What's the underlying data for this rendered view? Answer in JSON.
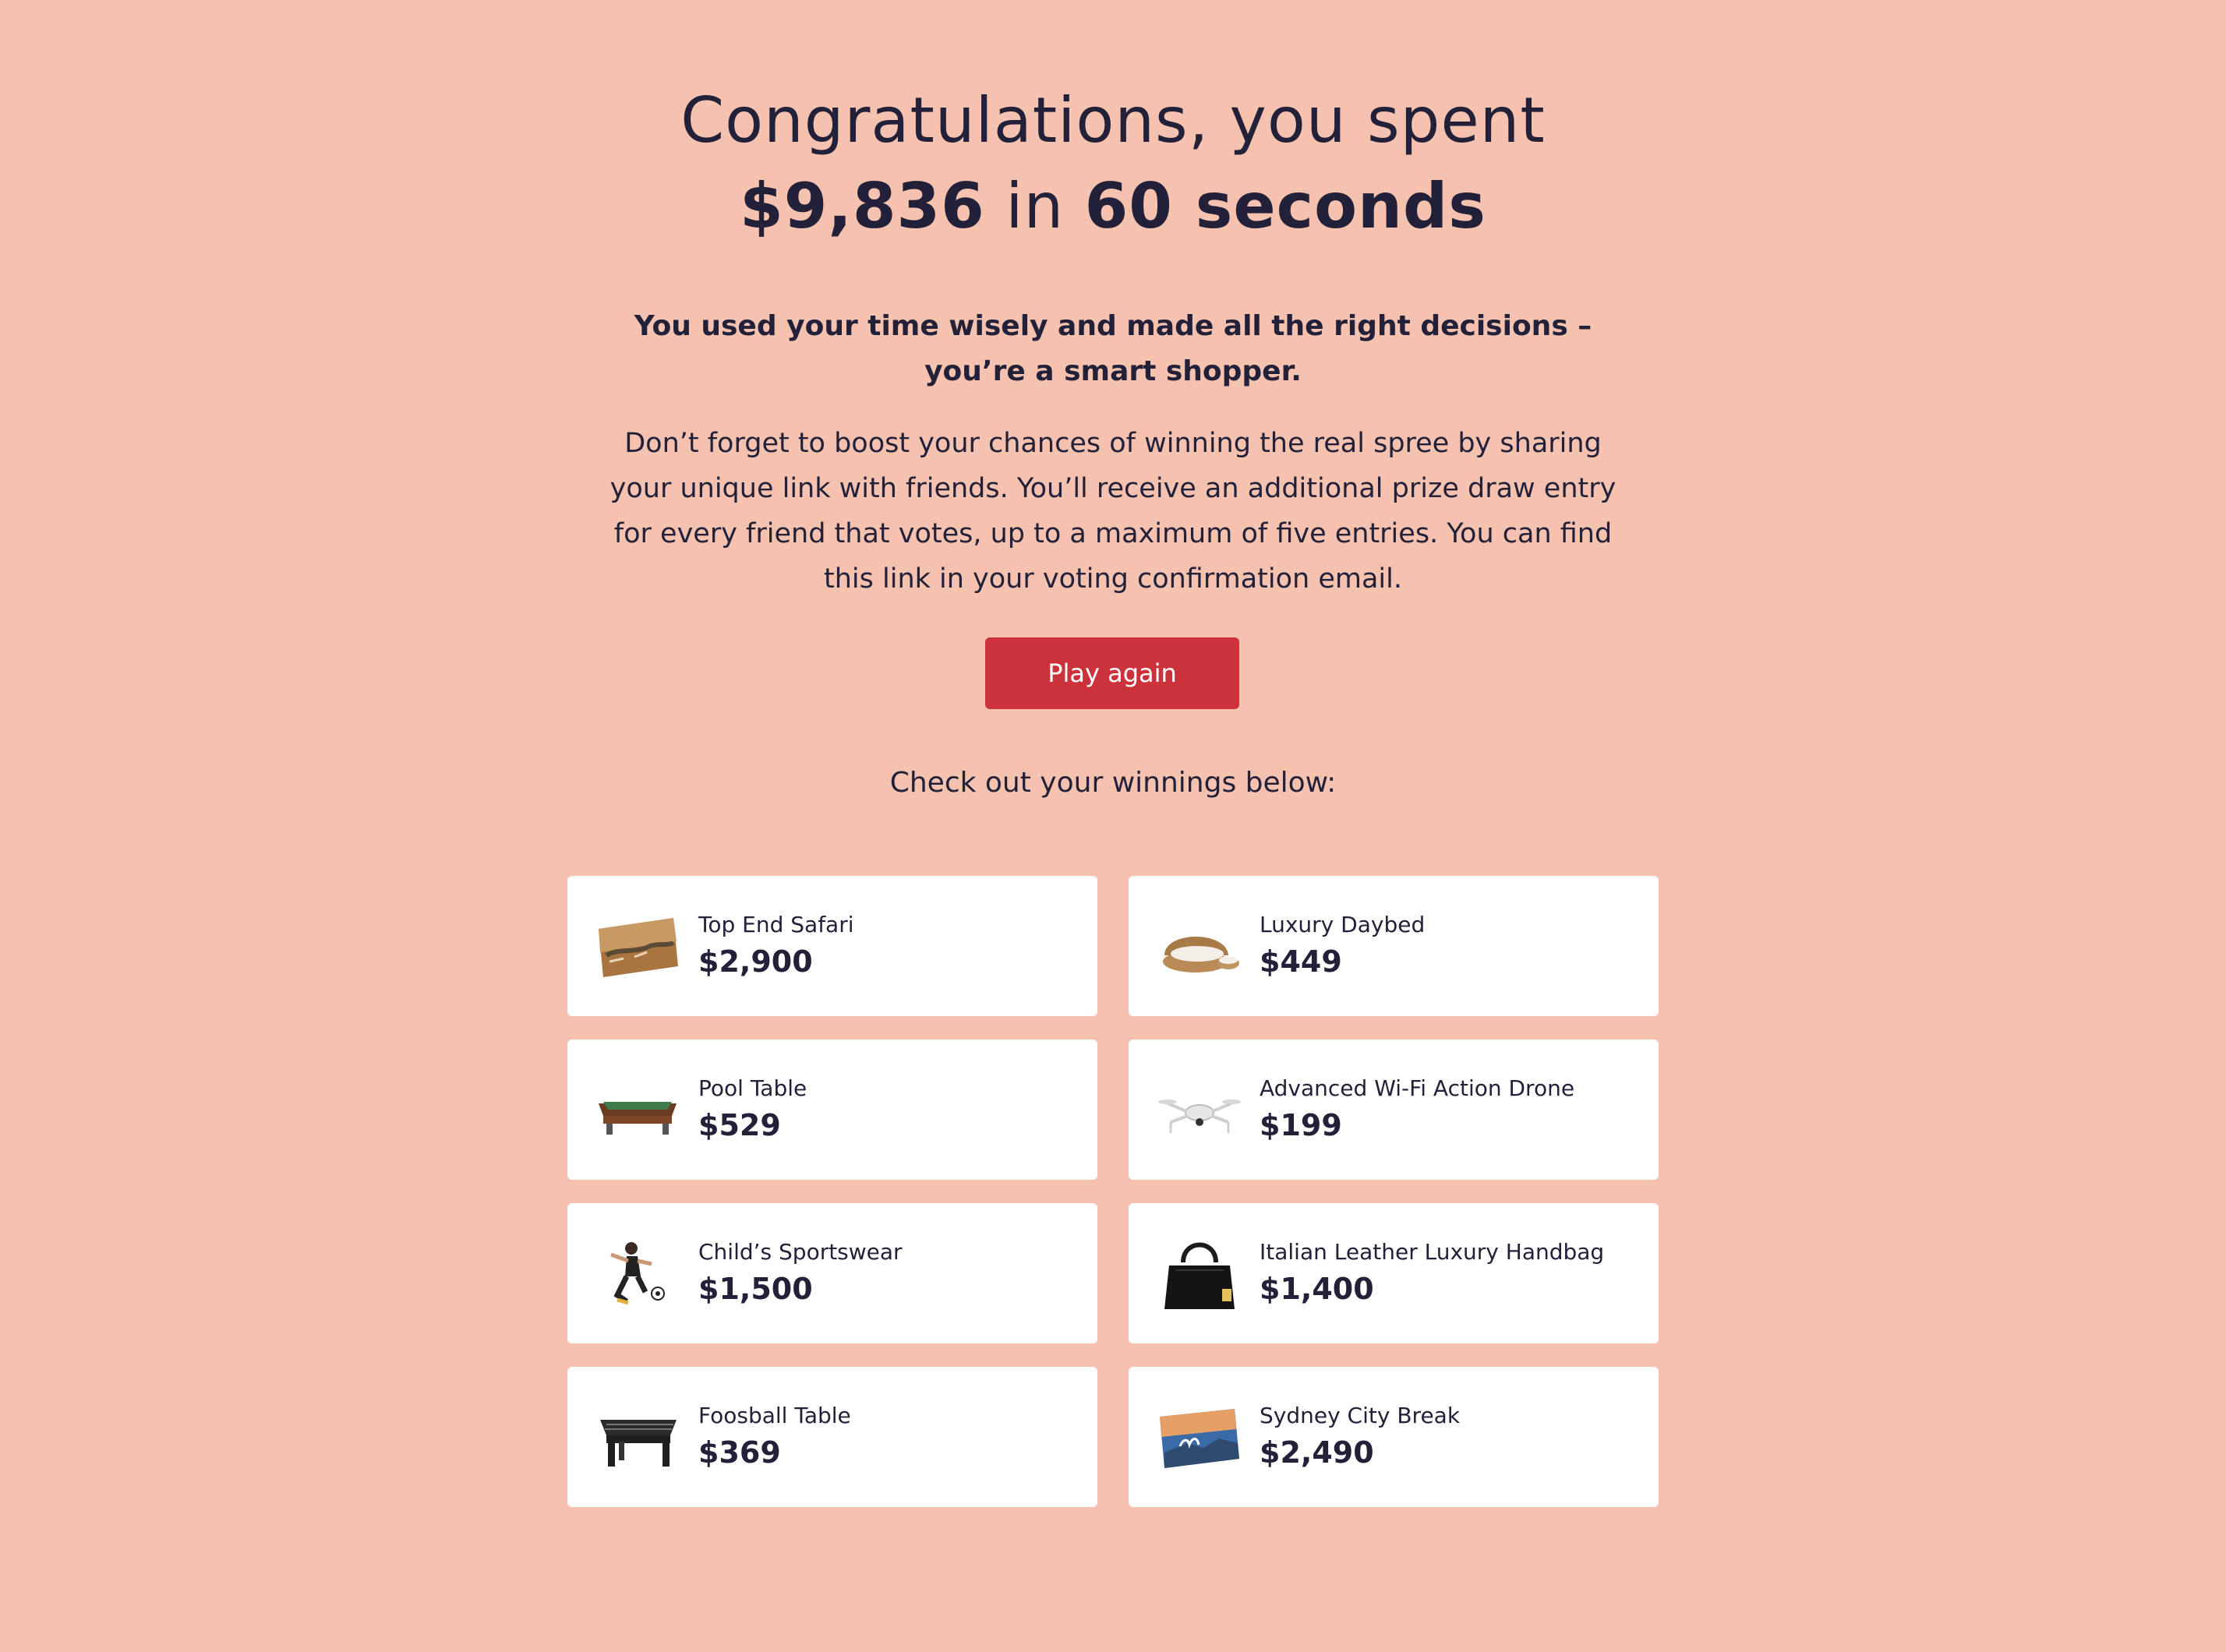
{
  "headline": {
    "line1": "Congratulations, you spent",
    "amount": "$9,836",
    "connector": " in ",
    "duration": "60 seconds"
  },
  "lead": "You used your time wisely and made all the right decisions – you’re a smart shopper.",
  "body": "Don’t forget to boost your chances of winning the real spree by sharing your unique link with friends. You’ll receive an additional prize draw entry for every friend that votes, up to a maximum of five entries. You can find this link in your voting confirmation email.",
  "play_again_label": "Play again",
  "winnings_label": "Check out your winnings below:",
  "prizes": [
    {
      "name": "Top End Safari",
      "price": "$2,900",
      "icon": "safari-icon"
    },
    {
      "name": "Luxury Daybed",
      "price": "$449",
      "icon": "daybed-icon"
    },
    {
      "name": "Pool Table",
      "price": "$529",
      "icon": "pool-table-icon"
    },
    {
      "name": "Advanced Wi-Fi Action Drone",
      "price": "$199",
      "icon": "drone-icon"
    },
    {
      "name": "Child’s Sportswear",
      "price": "$1,500",
      "icon": "sportswear-icon"
    },
    {
      "name": "Italian Leather Luxury Handbag",
      "price": "$1,400",
      "icon": "handbag-icon"
    },
    {
      "name": "Foosball Table",
      "price": "$369",
      "icon": "foosball-table-icon"
    },
    {
      "name": "Sydney City Break",
      "price": "$2,490",
      "icon": "sydney-icon"
    }
  ],
  "colors": {
    "background": "#f4c2af",
    "text": "#23213a",
    "button": "#cc323b",
    "card": "#ffffff"
  }
}
